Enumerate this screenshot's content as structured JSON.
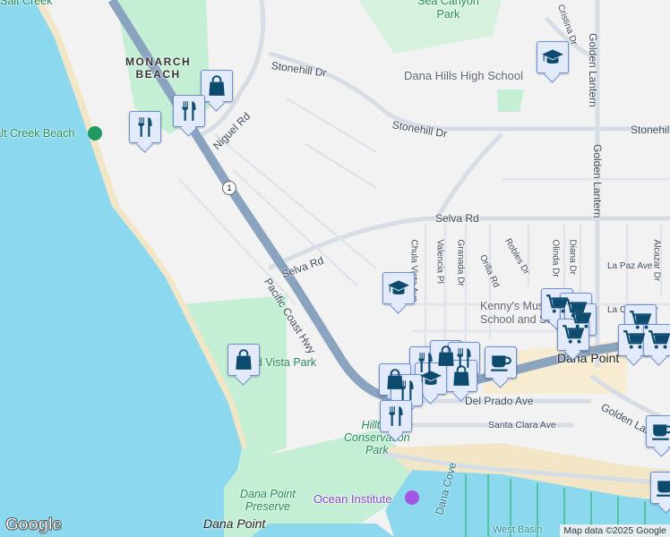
{
  "colors": {
    "water": "#8cd8ee",
    "land": "#f3f2f3",
    "park": "#c4efd5",
    "highway": "#8aa3bf",
    "road": "#d6dde5",
    "beach": "#f2e6c6",
    "marker_fill": "#e3ebfb",
    "marker_icon": "#0c4a6e"
  },
  "labels": {
    "salt_creek": "Salt Creek",
    "monarch_beach": "MONARCH\nBEACH",
    "salt_creek_beach": "Salt Creek Beach",
    "sea_canyon_park": "Sea Canyon\nPark",
    "dana_hills_hs": "Dana Hills High School",
    "stonehill_dr_1": "Stonehill Dr",
    "stonehill_dr_2": "Stonehill Dr",
    "stonehill_dr_3": "Stonehill Dr",
    "niguel_rd": "Niguel Rd",
    "golden_lantern_1": "Golden Lantern",
    "golden_lantern_2": "Golden Lantern",
    "selva_rd_1": "Selva Rd",
    "selva_rd_2": "Selva Rd",
    "pch": "Pacific Coast Hwy",
    "chula_vista": "Chula Vista Ave",
    "valencia": "Valencia Pl",
    "granada": "Granada Dr",
    "orilla": "Orilla Rd",
    "robles": "Robles Dr",
    "olinda": "Olinda Dr",
    "diana": "Diana Dr",
    "alcazar": "Alcazar Dr",
    "la_paz": "La Paz Ave",
    "la_cresta": "La Cresta Dr",
    "kennys": "Kenny's Music\nSchool and Studio",
    "dana_point_town": "Dana Point",
    "del_prado": "Del Prado Ave",
    "santa_clara": "Santa Clara Ave",
    "golden_lantern_3": "Golden Lantern",
    "hilltop": "Hilltop\nConservation\nPark",
    "strand_park": "Strand Vista Park",
    "dana_point_preserve": "Dana Point\nPreserve",
    "dana_point_bottom": "Dana Point",
    "ocean_institute": "Ocean Institute",
    "dana_cove": "Dana Cove",
    "west_basin": "West Basin",
    "cristina": "Cristina Dr",
    "route": "1"
  },
  "markers": [
    {
      "type": "shopping-bag"
    },
    {
      "type": "restaurant"
    },
    {
      "type": "restaurant"
    },
    {
      "type": "school"
    },
    {
      "type": "school"
    },
    {
      "type": "shopping-bag"
    },
    {
      "type": "cart"
    },
    {
      "type": "cart"
    },
    {
      "type": "cart"
    },
    {
      "type": "cart"
    },
    {
      "type": "cart"
    },
    {
      "type": "cart"
    },
    {
      "type": "cart"
    },
    {
      "type": "restaurant"
    },
    {
      "type": "shopping-bag"
    },
    {
      "type": "restaurant"
    },
    {
      "type": "coffee"
    },
    {
      "type": "shopping-bag"
    },
    {
      "type": "school"
    },
    {
      "type": "shopping-bag"
    },
    {
      "type": "restaurant"
    },
    {
      "type": "restaurant"
    },
    {
      "type": "coffee"
    },
    {
      "type": "coffee"
    }
  ],
  "footer": {
    "logo": "Google",
    "attribution": "Map data ©2025 Google"
  }
}
